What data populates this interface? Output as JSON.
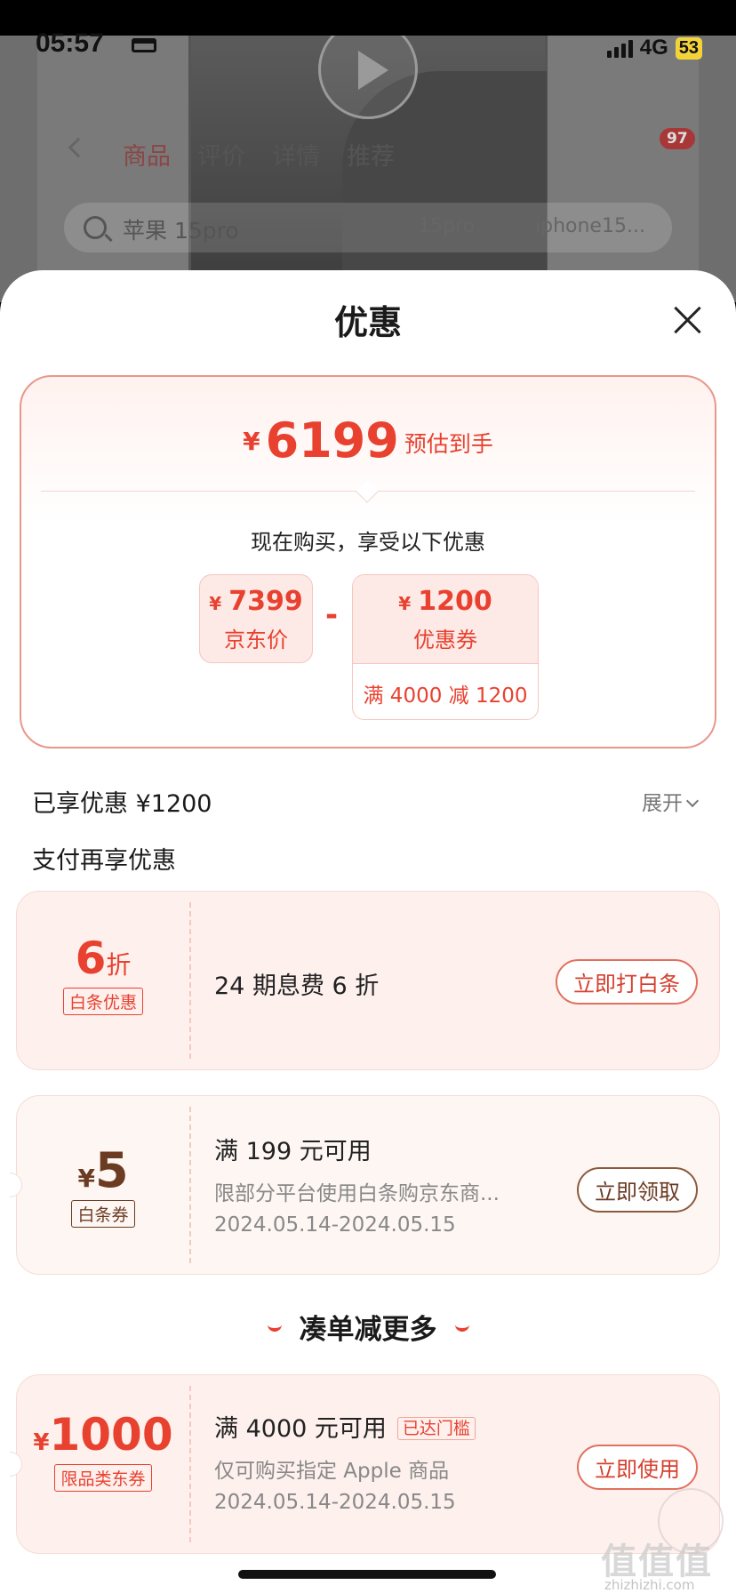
{
  "status_bar": {
    "time": "05:57",
    "network": "4G",
    "battery": "53"
  },
  "background_page": {
    "tabs": [
      "商品",
      "评价",
      "详情",
      "推荐"
    ],
    "cart_badge": "97",
    "search_text": "苹果 15pro",
    "chips": [
      "15pro",
      "iphone15..."
    ]
  },
  "sheet": {
    "title": "优惠",
    "summary": {
      "currency": "¥",
      "est_price": "6199",
      "est_label": "预估到手",
      "now_buy": "现在购买，享受以下优惠",
      "jd_price": "7399",
      "jd_label": "京东价",
      "minus": "-",
      "coupon_value": "1200",
      "coupon_label": "优惠券",
      "coupon_condition": "满 4000 减 1200"
    },
    "enjoyed": "已享优惠 ¥1200",
    "expand": "展开",
    "pay_more": "支付再享优惠",
    "baitiao_discount": {
      "value": "6",
      "unit": "折",
      "tag": "白条优惠",
      "text": "24 期息费 6 折",
      "action": "立即打白条"
    },
    "baitiao_coupon": {
      "currency": "¥",
      "value": "5",
      "tag": "白条券",
      "line1": "满 199 元可用",
      "line2": "限部分平台使用白条购京东商...",
      "line3": "2024.05.14-2024.05.15",
      "action": "立即领取"
    },
    "more_heading": "凑单减更多",
    "category_coupon": {
      "currency": "¥",
      "value": "1000",
      "tag": "限品类东券",
      "line1": "满 4000 元可用",
      "reached": "已达门槛",
      "line2": "仅可购买指定 Apple 商品",
      "line3": "2024.05.14-2024.05.15",
      "action": "立即使用"
    }
  },
  "watermark": {
    "logo": "值值值",
    "url": "zhizhizhi.com"
  }
}
